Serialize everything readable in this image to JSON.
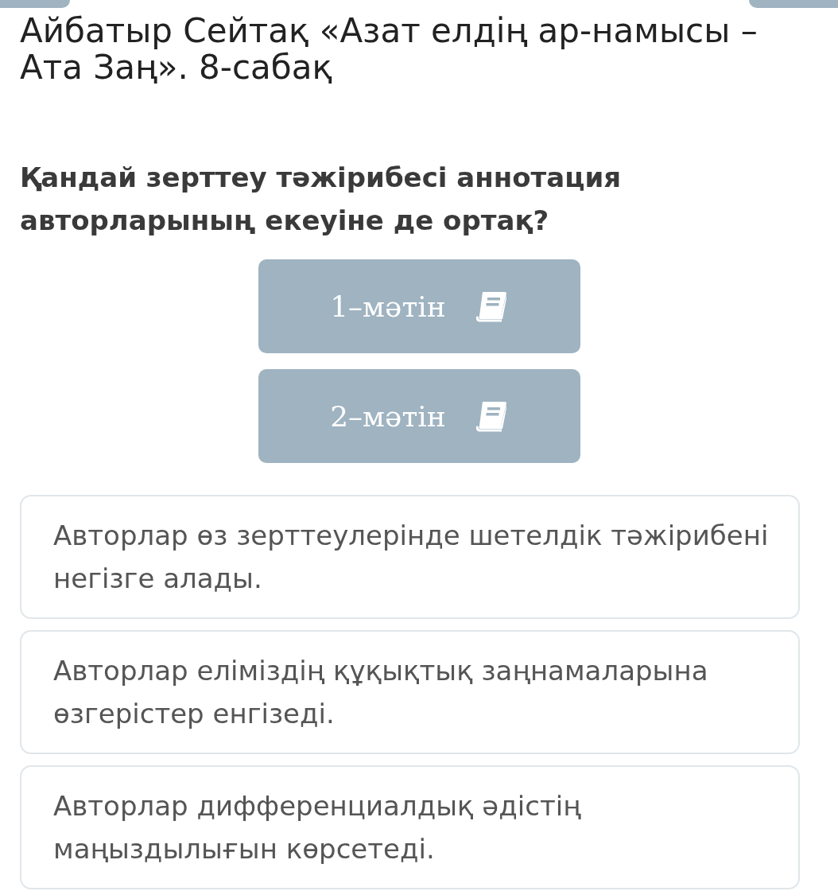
{
  "title": "Айбатыр Сейтақ «Азат елдің ар-намысы – Ата Заң». 8-сабақ",
  "question": "Қандай зерттеу тәжірибесі аннотация авторларының екеуіне де ортақ?",
  "texts": [
    {
      "label": "1–мәтін"
    },
    {
      "label": "2–мәтін"
    }
  ],
  "answers": [
    {
      "text": "Авторлар өз зерттеулерінде шетелдік тәжірибені негізге алады."
    },
    {
      "text": "Авторлар еліміздің құқықтық заңнамаларына өзгерістер енгізеді."
    },
    {
      "text": "Авторлар дифференциалдық әдістің маңыздылығын көрсетеді."
    }
  ]
}
